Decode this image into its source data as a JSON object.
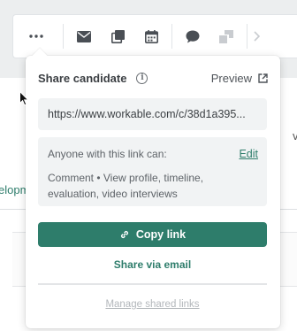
{
  "background": {
    "link_fragment": "elopm",
    "edge_fragment": "v"
  },
  "toolbar": {
    "items": [
      {
        "icon": "more-icon",
        "label": "More actions"
      },
      {
        "icon": "envelope-icon",
        "label": "Email"
      },
      {
        "icon": "open-external-icon",
        "label": "Open"
      },
      {
        "icon": "calendar-icon",
        "label": "Schedule"
      },
      {
        "icon": "comment-icon",
        "label": "Comment"
      },
      {
        "icon": "move-icon",
        "label": "Move",
        "disabled": true
      }
    ]
  },
  "share_popover": {
    "title": "Share candidate",
    "preview_label": "Preview",
    "url": "https://www.workable.com/c/38d1a395...",
    "permissions_heading": "Anyone with this link can:",
    "edit_label": "Edit",
    "permissions": "Comment • View profile, timeline, evaluation, video interviews",
    "copy_label": "Copy link",
    "email_label": "Share via email",
    "manage_label": "Manage shared links"
  },
  "colors": {
    "accent": "#2e7d6b",
    "input_bg": "#f1f3f4",
    "muted_text": "#b3b7bb"
  }
}
